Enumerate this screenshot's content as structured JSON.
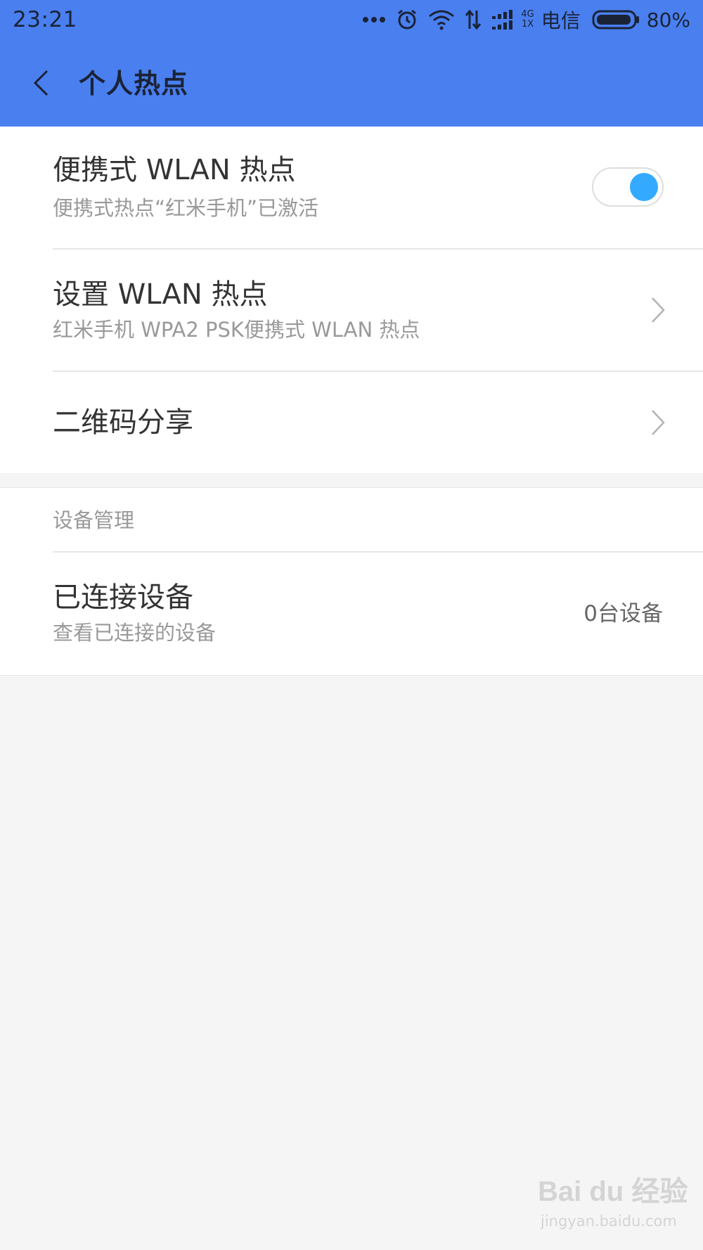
{
  "status_bar": {
    "time": "23:21",
    "carrier": "电信",
    "battery": "80%",
    "network_top": "4G",
    "network_bottom": "1X",
    "icons": [
      "more-dots-icon",
      "alarm-icon",
      "wifi-icon",
      "data-transfer-icon",
      "signal-icon",
      "battery-icon"
    ]
  },
  "header": {
    "title": "个人热点",
    "back_icon": "chevron-left-icon",
    "color": "#4a7fef"
  },
  "hotspot_section": {
    "portable_wlan": {
      "title": "便携式 WLAN 热点",
      "subtitle": "便携式热点“红米手机”已激活",
      "enabled": true,
      "toggle_color": "#33aaff"
    },
    "setup_wlan": {
      "title": "设置 WLAN 热点",
      "subtitle": "红米手机 WPA2 PSK便携式 WLAN 热点",
      "icon": "chevron-right-icon"
    },
    "qr_share": {
      "title": "二维码分享",
      "icon": "chevron-right-icon"
    }
  },
  "device_section": {
    "header": "设备管理",
    "connected_devices": {
      "title": "已连接设备",
      "subtitle": "查看已连接的设备",
      "value": "0台设备"
    }
  },
  "watermark": {
    "brand": "Bai du 经验",
    "url": "jingyan.baidu.com"
  }
}
